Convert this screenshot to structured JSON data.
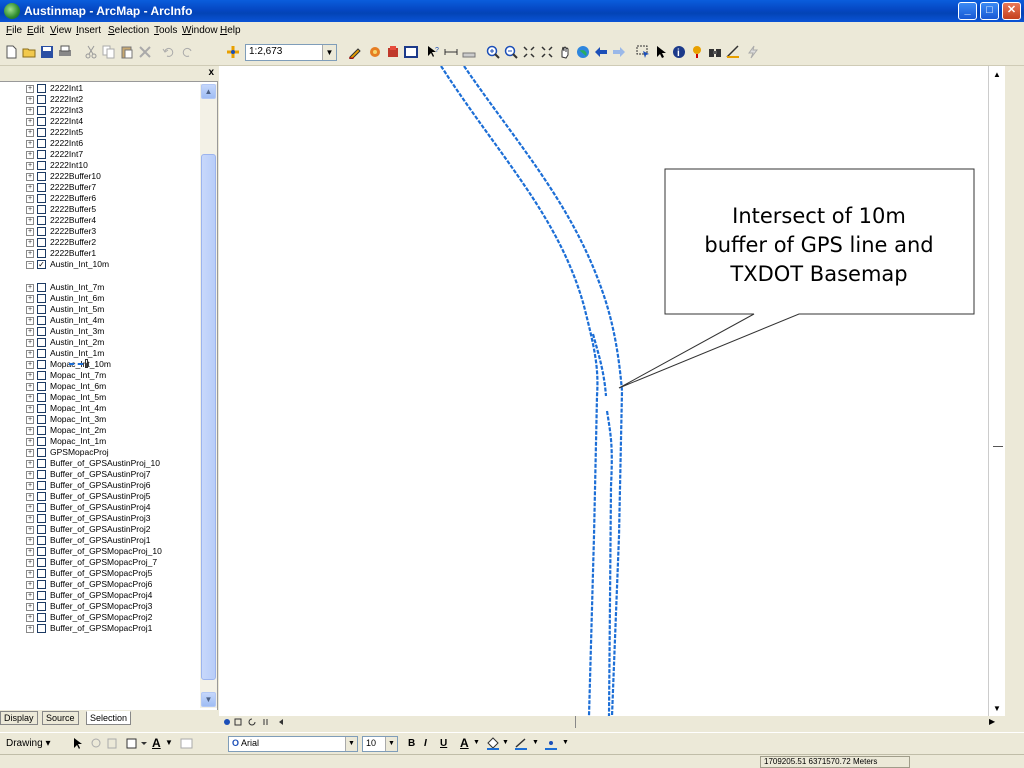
{
  "window": {
    "title": "Austinmap - ArcMap - ArcInfo",
    "controls": {
      "minimize": "_",
      "maximize": "□",
      "close": "✕"
    }
  },
  "menu": [
    "File",
    "Edit",
    "View",
    "Insert",
    "Selection",
    "Tools",
    "Window",
    "Help"
  ],
  "toolbar": {
    "scale_value": "1:2,673",
    "icons": [
      "new-icon",
      "open-icon",
      "save-icon",
      "print-icon",
      "cut-icon",
      "copy-icon",
      "paste-icon",
      "delete-icon",
      "undo-icon",
      "redo-icon",
      "add-data-icon"
    ]
  },
  "toc": {
    "close_label": "x",
    "layers": [
      {
        "name": "2222Int1",
        "checked": false
      },
      {
        "name": "2222Int2",
        "checked": false
      },
      {
        "name": "2222Int3",
        "checked": false
      },
      {
        "name": "2222Int4",
        "checked": false
      },
      {
        "name": "2222Int5",
        "checked": false
      },
      {
        "name": "2222Int6",
        "checked": false
      },
      {
        "name": "2222Int7",
        "checked": false
      },
      {
        "name": "2222Int10",
        "checked": false
      },
      {
        "name": "2222Buffer10",
        "checked": false
      },
      {
        "name": "2222Buffer7",
        "checked": false
      },
      {
        "name": "2222Buffer6",
        "checked": false
      },
      {
        "name": "2222Buffer5",
        "checked": false
      },
      {
        "name": "2222Buffer4",
        "checked": false
      },
      {
        "name": "2222Buffer3",
        "checked": false
      },
      {
        "name": "2222Buffer2",
        "checked": false
      },
      {
        "name": "2222Buffer1",
        "checked": false
      },
      {
        "name": "Austin_Int_10m",
        "checked": true,
        "expanded": true
      },
      {
        "name": "Austin_Int_7m",
        "checked": false
      },
      {
        "name": "Austin_Int_6m",
        "checked": false
      },
      {
        "name": "Austin_Int_5m",
        "checked": false
      },
      {
        "name": "Austin_Int_4m",
        "checked": false
      },
      {
        "name": "Austin_Int_3m",
        "checked": false
      },
      {
        "name": "Austin_Int_2m",
        "checked": false
      },
      {
        "name": "Austin_Int_1m",
        "checked": false
      },
      {
        "name": "Mopac_Int_10m",
        "checked": false
      },
      {
        "name": "Mopac_Int_7m",
        "checked": false
      },
      {
        "name": "Mopac_Int_6m",
        "checked": false
      },
      {
        "name": "Mopac_Int_5m",
        "checked": false
      },
      {
        "name": "Mopac_Int_4m",
        "checked": false
      },
      {
        "name": "Mopac_Int_3m",
        "checked": false
      },
      {
        "name": "Mopac_Int_2m",
        "checked": false
      },
      {
        "name": "Mopac_Int_1m",
        "checked": false
      },
      {
        "name": "GPSMopacProj",
        "checked": false
      },
      {
        "name": "Buffer_of_GPSAustinProj_10",
        "checked": false
      },
      {
        "name": "Buffer_of_GPSAustinProj7",
        "checked": false
      },
      {
        "name": "Buffer_of_GPSAustinProj6",
        "checked": false
      },
      {
        "name": "Buffer_of_GPSAustinProj5",
        "checked": false
      },
      {
        "name": "Buffer_of_GPSAustinProj4",
        "checked": false
      },
      {
        "name": "Buffer_of_GPSAustinProj3",
        "checked": false
      },
      {
        "name": "Buffer_of_GPSAustinProj2",
        "checked": false
      },
      {
        "name": "Buffer_of_GPSAustinProj1",
        "checked": false
      },
      {
        "name": "Buffer_of_GPSMopacProj_10",
        "checked": false
      },
      {
        "name": "Buffer_of_GPSMopacProj_7",
        "checked": false
      },
      {
        "name": "Buffer_of_GPSMopacProj5",
        "checked": false
      },
      {
        "name": "Buffer_of_GPSMopacProj6",
        "checked": false
      },
      {
        "name": "Buffer_of_GPSMopacProj4",
        "checked": false
      },
      {
        "name": "Buffer_of_GPSMopacProj3",
        "checked": false
      },
      {
        "name": "Buffer_of_GPSMopacProj2",
        "checked": false
      },
      {
        "name": "Buffer_of_GPSMopacProj1",
        "checked": false
      }
    ],
    "tabs": [
      "Display",
      "Source",
      "Selection"
    ]
  },
  "map": {
    "line_color": "#1c6ed6",
    "callout_lines": [
      "Intersect of 10m",
      "buffer of GPS line and",
      "TXDOT Basemap"
    ]
  },
  "drawing_toolbar": {
    "drawing_label": "Drawing",
    "font_name": "Arial",
    "font_size": "10",
    "bold": "B",
    "italic": "I",
    "underline": "U",
    "font_color_label": "A"
  },
  "status": {
    "coordinates": "1709205.51  6371570.72 Meters"
  }
}
